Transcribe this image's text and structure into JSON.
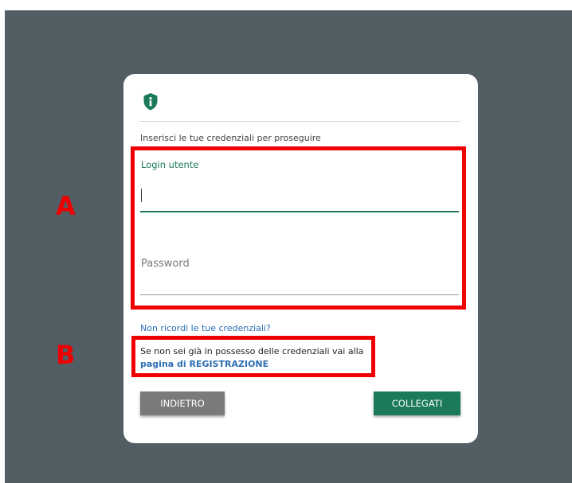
{
  "dialog": {
    "instruction": "Inserisci le tue credenziali per proseguire",
    "login": {
      "label": "Login utente",
      "value": ""
    },
    "password": {
      "label": "Password",
      "value": ""
    },
    "forgot_link": "Non ricordi le tue credenziali?",
    "register_text": "Se non sei già in possesso delle credenziali vai alla",
    "register_link": "pagina di REGISTRAZIONE",
    "back_button": "INDIETRO",
    "connect_button": "COLLEGATI"
  },
  "annotations": {
    "a": "A",
    "b": "B"
  },
  "colors": {
    "backdrop": "#525e64",
    "accent_green": "#1c7a5c",
    "link_blue": "#2c6db3",
    "annotation_red": "#ee0000",
    "back_button_gray": "#7a7a7a"
  },
  "icons": {
    "header": "shield-info-icon"
  }
}
